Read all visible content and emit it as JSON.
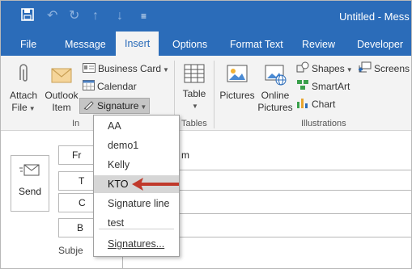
{
  "titlebar": {
    "title": "Untitled - Mess",
    "quick_access": [
      "save-icon",
      "undo-icon",
      "redo-icon",
      "up-arrow-icon",
      "down-arrow-icon",
      "customize-icon"
    ]
  },
  "tabs": [
    {
      "label": "File",
      "active": false
    },
    {
      "label": "Message",
      "active": false
    },
    {
      "label": "Insert",
      "active": true
    },
    {
      "label": "Options",
      "active": false
    },
    {
      "label": "Format Text",
      "active": false
    },
    {
      "label": "Review",
      "active": false
    },
    {
      "label": "Developer",
      "active": false
    }
  ],
  "ribbon": {
    "attach_file": {
      "line1": "Attach",
      "line2": "File"
    },
    "outlook_item": {
      "line1": "Outlook",
      "line2": "Item"
    },
    "business_card": "Business Card",
    "calendar": "Calendar",
    "signature": "Signature",
    "table": "Table",
    "pictures": "Pictures",
    "online_pictures": {
      "line1": "Online",
      "line2": "Pictures"
    },
    "shapes": "Shapes",
    "smartart": "SmartArt",
    "chart": "Chart",
    "screenshot": "Screens",
    "group_include": "In",
    "group_tables": "Tables",
    "group_illustrations": "Illustrations"
  },
  "compose": {
    "send": "Send",
    "from": "Fr",
    "to": "T",
    "cc": "C",
    "bcc": "B",
    "from_value": "m",
    "subject": "Subje"
  },
  "signature_menu": {
    "items": [
      "AA",
      "demo1",
      "Kelly",
      "KTO",
      "Signature line",
      "test"
    ],
    "highlighted": "KTO",
    "footer": "Signatures..."
  },
  "colors": {
    "accent": "#2b6cb9",
    "ribbon_bg": "#f3f3f3",
    "arrow": "#c0392b",
    "highlight": "#d6d6d6"
  }
}
